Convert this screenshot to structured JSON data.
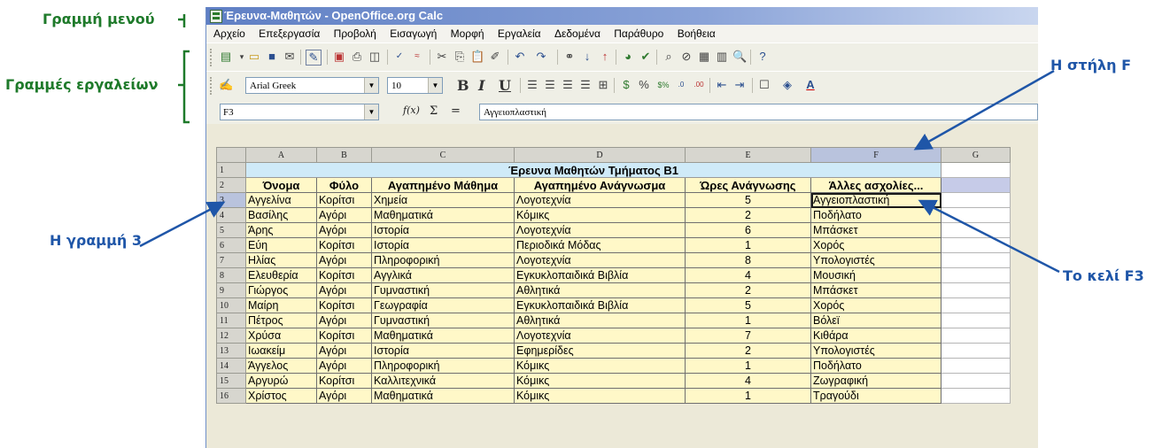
{
  "annotations": {
    "menu_bar": "Γραμμή μενού",
    "toolbars": "Γραμμές εργαλείων",
    "row3": "Η γραμμή 3",
    "column_f": "Η στήλη F",
    "cell_f3": "Το κελί F3"
  },
  "window": {
    "title": "Έρευνα-Μαθητών - OpenOffice.org Calc"
  },
  "menu": [
    "Αρχείο",
    "Επεξεργασία",
    "Προβολή",
    "Εισαγωγή",
    "Μορφή",
    "Εργαλεία",
    "Δεδομένα",
    "Παράθυρο",
    "Βοήθεια"
  ],
  "toolbar": {
    "font_name": "Arial Greek",
    "font_size": "10",
    "bold": "B",
    "italic": "I",
    "underline": "U"
  },
  "formula_bar": {
    "cell_ref": "F3",
    "fx": "f(x)",
    "sum": "Σ",
    "equals": "=",
    "content": "Αγγειοπλαστική"
  },
  "grid": {
    "columns": [
      "A",
      "B",
      "C",
      "D",
      "E",
      "F",
      "G"
    ],
    "row_numbers": [
      "1",
      "2",
      "3",
      "4",
      "5",
      "6",
      "7",
      "8",
      "9",
      "10",
      "11",
      "12",
      "13",
      "14",
      "15",
      "16"
    ],
    "title": "Έρευνα Μαθητών Τμήματος Β1",
    "headers": [
      "Όνομα",
      "Φύλο",
      "Αγαπημένο Μάθημα",
      "Αγαπημένο Ανάγνωσμα",
      "Ώρες Ανάγνωσης",
      "Άλλες ασχολίες..."
    ],
    "rows": [
      [
        "Αγγελίνα",
        "Κορίτσι",
        "Χημεία",
        "Λογοτεχνία",
        "5",
        "Αγγειοπλαστική"
      ],
      [
        "Βασίλης",
        "Αγόρι",
        "Μαθηματικά",
        "Κόμικς",
        "2",
        "Ποδήλατο"
      ],
      [
        "Άρης",
        "Αγόρι",
        "Ιστορία",
        "Λογοτεχνία",
        "6",
        "Μπάσκετ"
      ],
      [
        "Εύη",
        "Κορίτσι",
        "Ιστορία",
        "Περιοδικά Μόδας",
        "1",
        "Χορός"
      ],
      [
        "Ηλίας",
        "Αγόρι",
        "Πληροφορική",
        "Λογοτεχνία",
        "8",
        "Υπολογιστές"
      ],
      [
        "Ελευθερία",
        "Κορίτσι",
        "Αγγλικά",
        "Εγκυκλοπαιδικά Βιβλία",
        "4",
        "Μουσική"
      ],
      [
        "Γιώργος",
        "Αγόρι",
        "Γυμναστική",
        "Αθλητικά",
        "2",
        "Μπάσκετ"
      ],
      [
        "Μαίρη",
        "Κορίτσι",
        "Γεωγραφία",
        "Εγκυκλοπαιδικά Βιβλία",
        "5",
        "Χορός"
      ],
      [
        "Πέτρος",
        "Αγόρι",
        "Γυμναστική",
        "Αθλητικά",
        "1",
        "Βόλεϊ"
      ],
      [
        "Χρύσα",
        "Κορίτσι",
        "Μαθηματικά",
        "Λογοτεχνία",
        "7",
        "Κιθάρα"
      ],
      [
        "Ιωακείμ",
        "Αγόρι",
        "Ιστορία",
        "Εφημερίδες",
        "2",
        "Υπολογιστές"
      ],
      [
        "Άγγελος",
        "Αγόρι",
        "Πληροφορική",
        "Κόμικς",
        "1",
        "Ποδήλατο"
      ],
      [
        "Αργυρώ",
        "Κορίτσι",
        "Καλλιτεχνικά",
        "Κόμικς",
        "4",
        "Ζωγραφική"
      ],
      [
        "Χρίστος",
        "Αγόρι",
        "Μαθηματικά",
        "Κόμικς",
        "1",
        "Τραγούδι"
      ]
    ]
  },
  "colors": {
    "annotation_green": "#1e7a2a",
    "annotation_blue": "#1f56a8",
    "title_fill": "#cfeaf8",
    "data_fill": "#fff8c8"
  }
}
